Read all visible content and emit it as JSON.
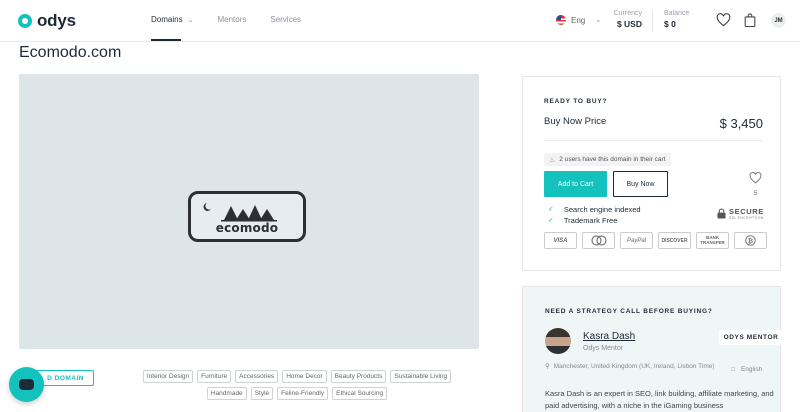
{
  "header": {
    "brand": "odys",
    "nav": [
      {
        "label": "Domains",
        "active": true,
        "has_dropdown": true
      },
      {
        "label": "Mentors",
        "active": false
      },
      {
        "label": "Services",
        "active": false
      }
    ],
    "language": "Eng",
    "currency_label": "Currency",
    "currency_value": "$ USD",
    "balance_label": "Balance",
    "balance_value": "$ 0",
    "user_initials": "JM",
    "icons": [
      "heart-icon",
      "cart-icon",
      "chevron-down-icon",
      "us-flag-icon"
    ]
  },
  "domain": {
    "name": "Ecomodo.com",
    "logo_text": "ecomodo"
  },
  "featured_button": "D DOMAIN",
  "tags": {
    "row1": [
      "Interior Design",
      "Furniture",
      "Accessories",
      "Home Decor",
      "Beauty Products",
      "Sustainable Living"
    ],
    "row2": [
      "Handmade",
      "Style",
      "Feline-Friendly",
      "Ethical Sourcing"
    ]
  },
  "buy": {
    "eyebrow": "READY TO BUY?",
    "label": "Buy Now Price",
    "price": "$ 3,450",
    "watchers_note": "2 users have this domain in their cart",
    "add_to_cart": "Add to Cart",
    "buy_now": "Buy Now",
    "favorites_count": "5",
    "checks": [
      "Search engine indexed",
      "Trademark Free"
    ],
    "secure_label": "SECURE",
    "secure_sub": "SSL ENCRYPTION",
    "payments": [
      "VISA",
      "mastercard",
      "PayPal",
      "DISCOVER",
      "BANK TRANSFER",
      "bitcoin"
    ]
  },
  "mentor": {
    "eyebrow": "NEED A STRATEGY CALL BEFORE BUYING?",
    "name": "Kasra Dash",
    "role": "Odys Mentor",
    "badge": "ODYS MENTOR",
    "location": "Manchester, United Kingdom (UK, Ireland, Lisbon Time)",
    "language": "English",
    "bio": "Kasra Dash is an expert in SEO, link building, affiliate marketing, and paid advertising, with a niche in the iGaming business"
  },
  "colors": {
    "accent": "#13c1bd",
    "dark": "#1f2a37",
    "hero_bg": "#dde5e9",
    "mentor_bg": "#eef7f6"
  }
}
